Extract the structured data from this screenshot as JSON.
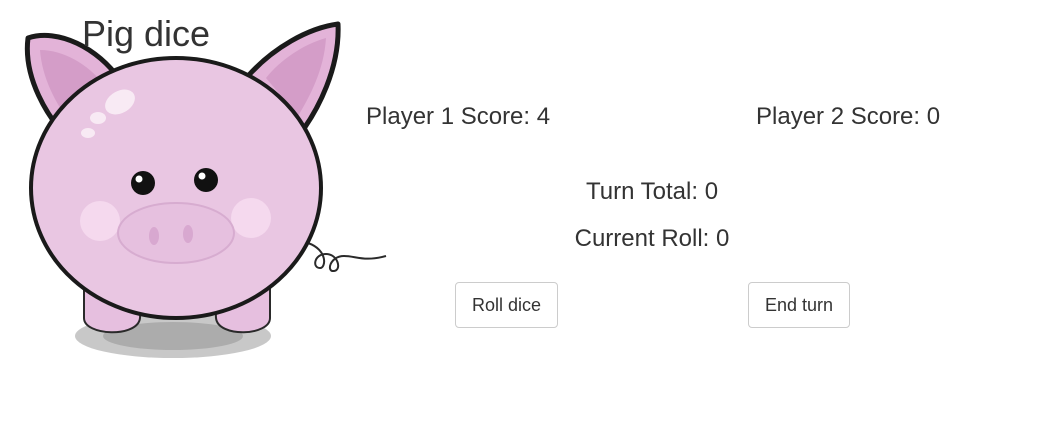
{
  "header": {
    "title": "Pig dice",
    "logo_icon": "pig-icon"
  },
  "scores": {
    "player1_label": "Player 1 Score:",
    "player1_value": "4",
    "player2_label": "Player 2 Score:",
    "player2_value": "0"
  },
  "turn": {
    "total_label": "Turn Total:",
    "total_value": "0",
    "roll_label": "Current Roll:",
    "roll_value": "0"
  },
  "actions": {
    "roll_label": "Roll dice",
    "end_label": "End turn"
  },
  "colors": {
    "pig_body": "#e9c6e2",
    "pig_outline": "#1a1a1a",
    "text": "#333333",
    "button_border": "#cccccc"
  }
}
